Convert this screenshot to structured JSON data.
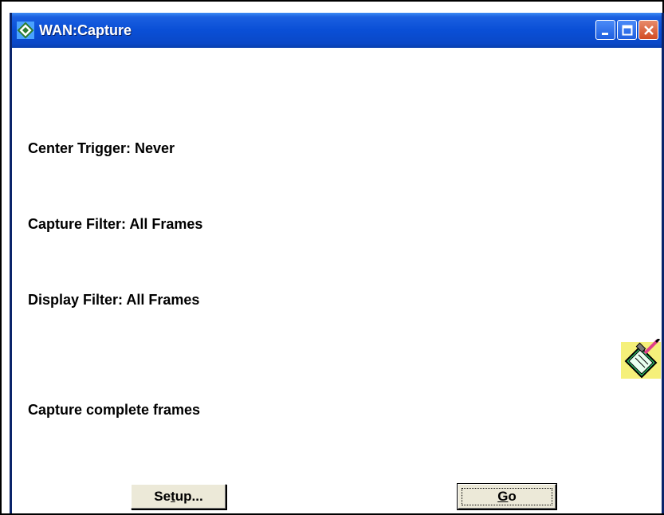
{
  "window": {
    "title": "WAN:Capture",
    "app_icon": "diamond-capture-icon"
  },
  "titlebar_buttons": {
    "minimize": "minimize-icon",
    "maximize": "maximize-icon",
    "close": "close-icon"
  },
  "settings": {
    "center_trigger": "Center Trigger: Never",
    "capture_filter": "Capture Filter: All Frames",
    "display_filter": "Display Filter: All Frames",
    "capture_mode": "Capture complete frames"
  },
  "buttons": {
    "setup_prefix": "Se",
    "setup_mnemonic": "t",
    "setup_suffix": "up...",
    "go_mnemonic": "G",
    "go_suffix": "o"
  },
  "icons": {
    "notes": "notepad-pencil-icon"
  },
  "colors": {
    "titlebar": "#0a4fd6",
    "close_button": "#d24b22",
    "button_face": "#ece9d8"
  }
}
